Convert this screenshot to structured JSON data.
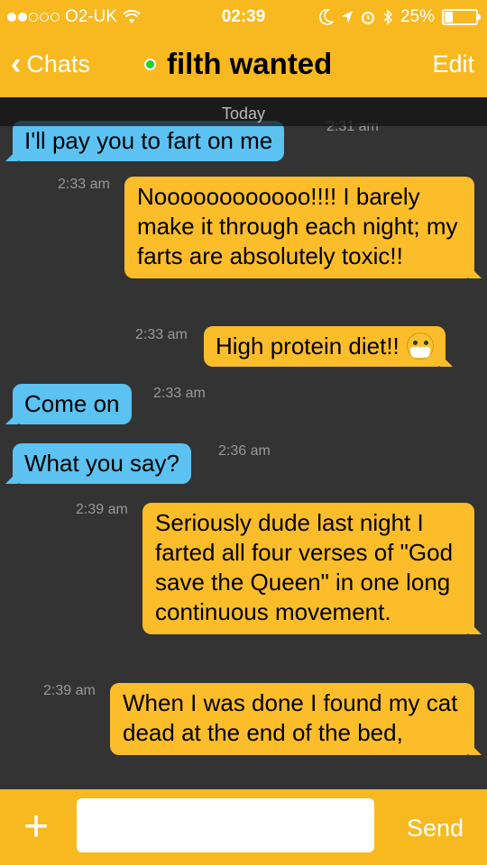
{
  "status_bar": {
    "carrier": "O2-UK",
    "time": "02:39",
    "battery": "25%",
    "battery_level": 0.25,
    "icons": [
      "signal-dots-icon",
      "wifi-icon",
      "moon-icon",
      "location-arrow-icon",
      "alarm-icon",
      "bluetooth-icon",
      "battery-icon"
    ]
  },
  "nav": {
    "back_label": "Chats",
    "title": "filth wanted",
    "edit_label": "Edit",
    "online_color": "#1fd22b"
  },
  "chat": {
    "date_label": "Today",
    "messages": [
      {
        "dir": "in",
        "text": "I'll pay you to fart on me",
        "time": "2:31 am"
      },
      {
        "dir": "out",
        "text": "Noooooooooooo!!!! I barely make it through each night; my farts are absolutely toxic!!",
        "time": "2:33 am"
      },
      {
        "dir": "out",
        "text": "High protein diet!!",
        "time": "2:33 am",
        "emoji": "face-with-medical-mask-icon"
      },
      {
        "dir": "in",
        "text": "Come on",
        "time": "2:33 am"
      },
      {
        "dir": "in",
        "text": "What you say?",
        "time": "2:36 am"
      },
      {
        "dir": "out",
        "text": "Seriously dude last night I farted all four verses of \"God save the Queen\" in one long continuous movement.",
        "time": "2:39 am"
      },
      {
        "dir": "out",
        "text": "When I was done I found my cat dead at the end of the bed,",
        "time": "2:39 am"
      }
    ]
  },
  "input_bar": {
    "plus_label": "+",
    "input_value": "",
    "send_label": "Send"
  },
  "colors": {
    "header": "#f8b920",
    "incoming_bubble": "#5bc2f1",
    "outgoing_bubble": "#fbbd2a",
    "background": "#333333"
  }
}
